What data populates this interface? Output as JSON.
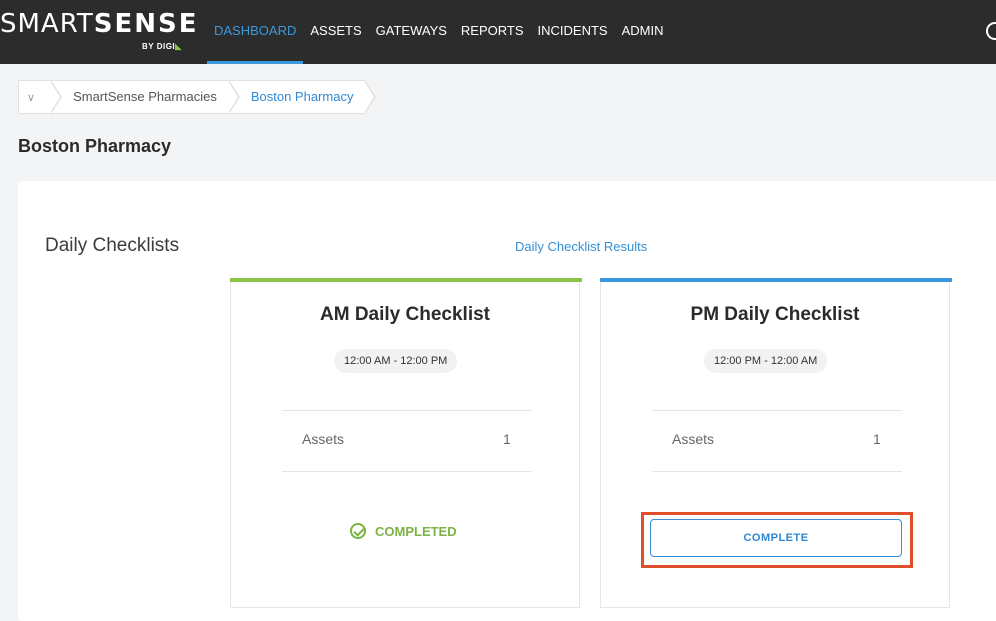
{
  "brand": {
    "name_light": "SMART",
    "name_bold": "SENSE",
    "by_text": "BY DIGI",
    "mark": "◣"
  },
  "nav": {
    "items": [
      {
        "label": "DASHBOARD",
        "active": true
      },
      {
        "label": "ASSETS",
        "active": false
      },
      {
        "label": "GATEWAYS",
        "active": false
      },
      {
        "label": "REPORTS",
        "active": false
      },
      {
        "label": "INCIDENTS",
        "active": false
      },
      {
        "label": "ADMIN",
        "active": false
      }
    ]
  },
  "breadcrumb": {
    "toggle_icon": "chevron-down-icon",
    "toggle_glyph": "∨",
    "items": [
      "SmartSense Pharmacies",
      "Boston Pharmacy"
    ]
  },
  "page": {
    "title": "Boston Pharmacy"
  },
  "section": {
    "title": "Daily Checklists",
    "results_link": "Daily Checklist Results"
  },
  "checklists": [
    {
      "title": "AM Daily Checklist",
      "time_range": "12:00 AM - 12:00 PM",
      "assets_label": "Assets",
      "assets_count": "1",
      "status": "COMPLETED",
      "accent_color": "#8bc34a"
    },
    {
      "title": "PM Daily Checklist",
      "time_range": "12:00 PM - 12:00 AM",
      "assets_label": "Assets",
      "assets_count": "1",
      "action_label": "COMPLETE",
      "accent_color": "#3c98dc"
    }
  ],
  "colors": {
    "nav_bg": "#2c2c2c",
    "accent_blue": "#3c98dc",
    "success_green": "#7cb342",
    "highlight": "#e04e2a"
  }
}
